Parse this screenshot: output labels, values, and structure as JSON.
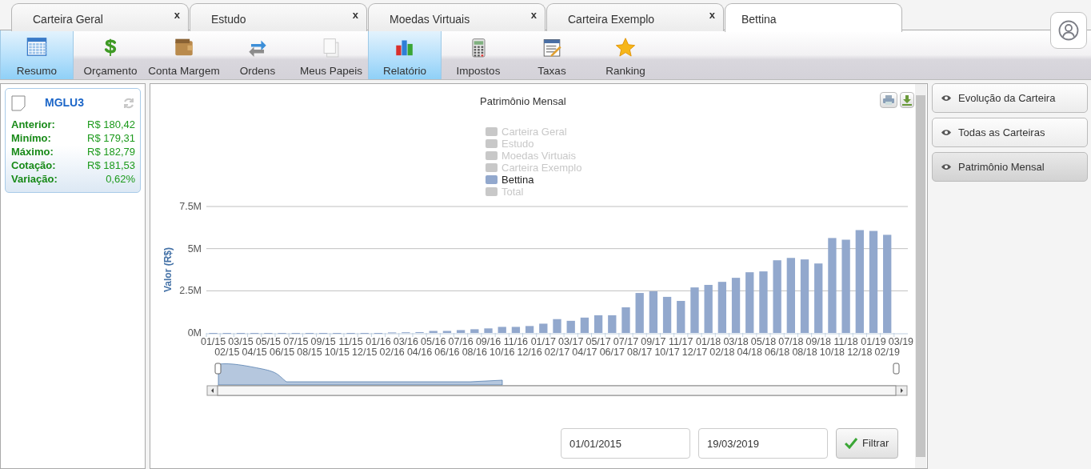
{
  "tabs": [
    {
      "label": "Carteira Geral",
      "close": "x",
      "selected": false
    },
    {
      "label": "Estudo",
      "close": "x",
      "selected": false
    },
    {
      "label": "Moedas Virtuais",
      "close": "x",
      "selected": false
    },
    {
      "label": "Carteira Exemplo",
      "close": "x",
      "selected": false
    },
    {
      "label": "Bettina",
      "selected": true
    }
  ],
  "toolbar": [
    {
      "label": "Resumo",
      "selected": true
    },
    {
      "label": "Orçamento",
      "selected": false
    },
    {
      "label": "Conta Margem",
      "selected": false
    },
    {
      "label": "Ordens",
      "selected": false
    },
    {
      "label": "Meus Papeis",
      "selected": false
    },
    {
      "label": "Relatório",
      "selected": true
    },
    {
      "label": "Impostos",
      "selected": false
    },
    {
      "label": "Taxas",
      "selected": false
    },
    {
      "label": "Ranking",
      "selected": false
    }
  ],
  "quote_card": {
    "ticker": "MGLU3",
    "rows": [
      {
        "label": "Anterior:",
        "value": "R$ 180,42"
      },
      {
        "label": "Minímo:",
        "value": "R$ 179,31"
      },
      {
        "label": "Máximo:",
        "value": "R$ 182,79"
      },
      {
        "label": "Cotação:",
        "value": "R$ 181,53"
      },
      {
        "label": "Variação:",
        "value": "0,62%"
      }
    ]
  },
  "chart": {
    "title": "Patrimônio Mensal",
    "legend": [
      {
        "label": "Carteira Geral",
        "hidden": true
      },
      {
        "label": "Estudo",
        "hidden": true
      },
      {
        "label": "Moedas Virtuais",
        "hidden": true
      },
      {
        "label": "Carteira Exemplo",
        "hidden": true
      },
      {
        "label": "Bettina",
        "hidden": false
      },
      {
        "label": "Total",
        "hidden": true
      }
    ],
    "chart_data": {
      "type": "bar",
      "ylabel": "Valor (R$)",
      "categories": [
        "01/15",
        "02/15",
        "03/15",
        "04/15",
        "05/15",
        "06/15",
        "07/15",
        "08/15",
        "09/15",
        "10/15",
        "11/15",
        "12/15",
        "01/16",
        "02/16",
        "03/16",
        "04/16",
        "05/16",
        "06/16",
        "07/16",
        "08/16",
        "09/16",
        "10/16",
        "11/16",
        "12/16",
        "01/17",
        "02/17",
        "03/17",
        "04/17",
        "05/17",
        "06/17",
        "07/17",
        "08/17",
        "09/17",
        "10/17",
        "11/17",
        "12/17",
        "01/18",
        "02/18",
        "03/18",
        "04/18",
        "05/18",
        "06/18",
        "07/18",
        "08/18",
        "09/18",
        "10/18",
        "11/18",
        "12/18",
        "01/19",
        "02/19",
        "03/19"
      ],
      "series": [
        {
          "color": "#92a8cd",
          "values": [
            0,
            0,
            0,
            0,
            0,
            0,
            0,
            0,
            0,
            0,
            0,
            0,
            0,
            0.03,
            0.04,
            0.05,
            0.12,
            0.12,
            0.17,
            0.22,
            0.27,
            0.36,
            0.36,
            0.41,
            0.55,
            0.82,
            0.72,
            0.91,
            1.05,
            1.05,
            1.52,
            2.37,
            2.47,
            2.14,
            1.9,
            2.7,
            2.85,
            3.03,
            3.27,
            3.6,
            3.65,
            4.31,
            4.45,
            4.36,
            4.12,
            5.63,
            5.53,
            6.1,
            6.05,
            5.82,
            null
          ]
        }
      ],
      "ylim": [
        0,
        7.5
      ],
      "yticks": [
        {
          "value": 0,
          "label": "0M"
        },
        {
          "value": 2.5,
          "label": "2.5M"
        },
        {
          "value": 5,
          "label": "5M"
        },
        {
          "value": 7.5,
          "label": "7.5M"
        }
      ]
    }
  },
  "date_from": {
    "value": "01/01/2015"
  },
  "date_to": {
    "value": "19/03/2019"
  },
  "filter_button": "Filtrar",
  "side_buttons": [
    {
      "label": "Evolução da Carteira",
      "selected": false
    },
    {
      "label": "Todas as Carteiras",
      "selected": false
    },
    {
      "label": "Patrimônio Mensal",
      "selected": true
    }
  ]
}
